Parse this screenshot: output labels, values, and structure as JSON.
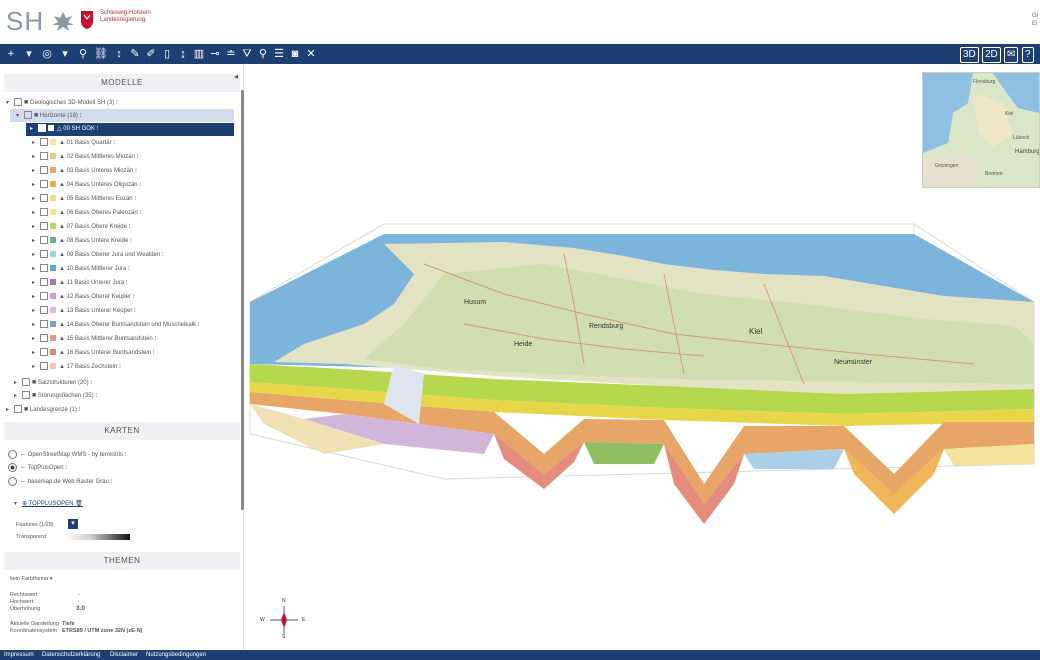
{
  "header": {
    "logo": "SH",
    "brand_line1": "Schleswig-Holstein",
    "brand_line2": "Landesregierung",
    "user_line1": "Gi",
    "user_line2": "Ei"
  },
  "toolbar": {
    "right_3d": "3D",
    "right_2d": "2D",
    "colors": {
      "bar": "#1d3f72"
    }
  },
  "sections": {
    "modelle": "MODELLE",
    "karten": "KARTEN",
    "themen": "THEMEN"
  },
  "tree": {
    "root": "Geologisches 3D-Modell SH (3) ⁝",
    "horizonte": "Horizonte (18) ⁝",
    "items": [
      {
        "label": "00 SH GOK ⁝",
        "color": ""
      },
      {
        "label": "01 Basis Quartär ⁝",
        "color": "#f2e6a8"
      },
      {
        "label": "02 Basis Mittleres Miozän ⁝",
        "color": "#e8c98a"
      },
      {
        "label": "03 Basis Unteres Miozän ⁝",
        "color": "#e8a76a"
      },
      {
        "label": "04 Basis Unteres Oligozän ⁝",
        "color": "#e2b44a"
      },
      {
        "label": "05 Basis Mittleres Eozän ⁝",
        "color": "#f1d98a"
      },
      {
        "label": "06 Basis Oberes Paleozän ⁝",
        "color": "#f4e48b"
      },
      {
        "label": "07 Basis Obere Kreide ⁝",
        "color": "#b9d46b"
      },
      {
        "label": "08 Basis Untere Kreide ⁝",
        "color": "#6ab58a"
      },
      {
        "label": "09 Basis Oberer Jura und Wealden ⁝",
        "color": "#9fd1e6"
      },
      {
        "label": "10 Basis Mittlerer Jura ⁝",
        "color": "#62a9c9"
      },
      {
        "label": "11 Basis Unterer Jura ⁝",
        "color": "#a575b9"
      },
      {
        "label": "12 Basis Oberer Keuper ⁝",
        "color": "#c9a0d1"
      },
      {
        "label": "13 Basis Unterer Keuper ⁝",
        "color": "#d9b8e0"
      },
      {
        "label": "14 Basis Oberer Buntsandstein und Muschelkalk ⁝",
        "color": "#7f9fcf"
      },
      {
        "label": "15 Basis Mittlerer Buntsandstein ⁝",
        "color": "#e19b8f"
      },
      {
        "label": "16 Basis Unterer Buntsandstein ⁝",
        "color": "#d98a7a"
      },
      {
        "label": "17 Basis Zechstein ⁝",
        "color": "#f4c2c2"
      }
    ],
    "salzstrukturen": "Salzstrukturen (20) ⁝",
    "stoerungen": "Störungsflächen (35) ⁝",
    "landesgrenze": "Landesgrenze (1) ⁝"
  },
  "karten": {
    "options": [
      {
        "label": "OpenStreetMap WMS - by terrestris ⁝",
        "selected": false
      },
      {
        "label": "TopPlusOpen ⁝",
        "selected": true
      },
      {
        "label": "basemap.de Web Raster Grau ⁝",
        "selected": false
      }
    ],
    "active_layer": "TOPPLUSOPEN",
    "features_label": "Features (1/28)",
    "transparency_label": "Transparenz"
  },
  "themen": {
    "theme_select": "kein Farbthema",
    "rechtswert_label": "Rechtswert",
    "rechtswert_value": "-",
    "hochwert_label": "Hochwert",
    "hochwert_value": "-",
    "ueberhoehung_label": "Überhöhung",
    "ueberhoehung_value": "3.0",
    "tiefe_label": "Aktuelle Darstellung",
    "tiefe_value": "Tiefe",
    "koord_label": "Koordinatensystem",
    "koord_value": "ETRS89 / UTM zone 32N (zE-N)"
  },
  "minimap": {
    "labels": [
      "Flensburg",
      "Kiel",
      "Lübeck",
      "Hamburg",
      "Groningen",
      "Bremen"
    ]
  },
  "compass": {
    "n": "N",
    "s": "S",
    "w": "W",
    "e": "E"
  },
  "map_labels": [
    "Husum",
    "Rendsburg",
    "Kiel",
    "Heide",
    "Neumünster"
  ],
  "footer": {
    "items": [
      "Impressum",
      "Datenschutzerklärung",
      "Disclaimer",
      "Nutzungsbedingungen"
    ]
  }
}
